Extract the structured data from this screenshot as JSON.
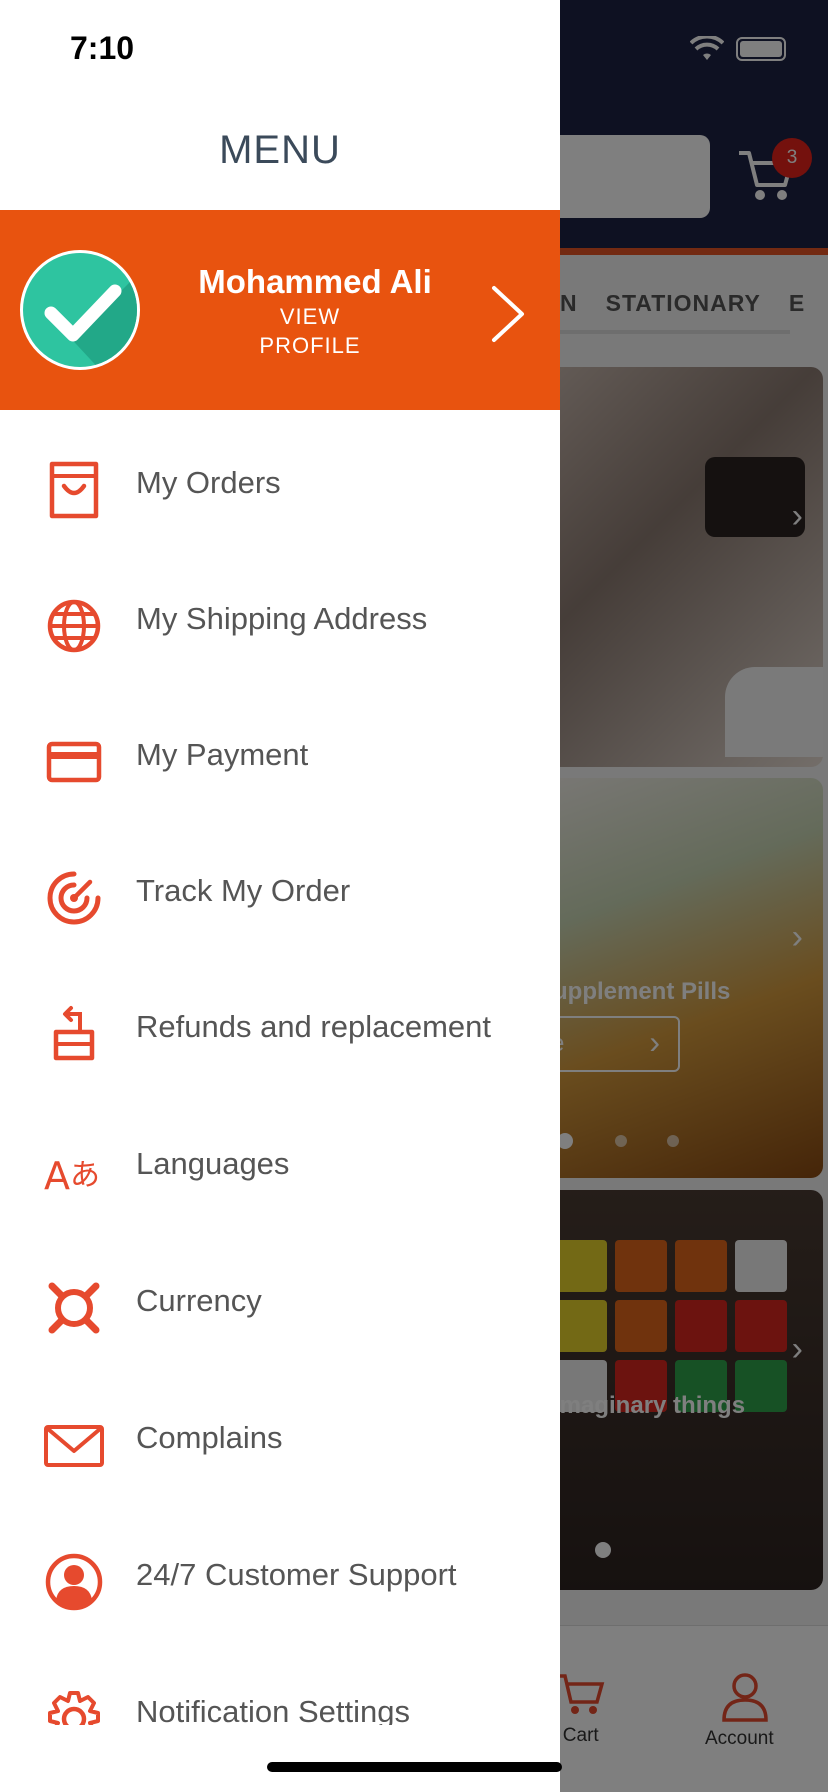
{
  "status_bar": {
    "time": "7:10"
  },
  "drawer": {
    "title": "MENU",
    "profile": {
      "name": "Mohammed Ali",
      "view_line1": "VIEW",
      "view_line2": "PROFILE"
    },
    "items": [
      {
        "label": "My Orders",
        "icon": "shopping-bag-icon"
      },
      {
        "label": "My Shipping Address",
        "icon": "globe-icon"
      },
      {
        "label": "My Payment",
        "icon": "credit-card-icon"
      },
      {
        "label": "Track My Order",
        "icon": "target-icon"
      },
      {
        "label": "Refunds and replacement",
        "icon": "refund-icon"
      },
      {
        "label": "Languages",
        "icon": "language-icon"
      },
      {
        "label": "Currency",
        "icon": "currency-icon"
      },
      {
        "label": "Complains",
        "icon": "mail-icon"
      },
      {
        "label": "24/7 Customer Support",
        "icon": "user-circle-icon"
      },
      {
        "label": "Notification Settings",
        "icon": "gear-icon"
      }
    ]
  },
  "background": {
    "cart_count": "3",
    "categories": [
      "N",
      "STATIONARY",
      "E"
    ],
    "cards": [
      {
        "text": ""
      },
      {
        "text": "upplement Pills",
        "button": "e"
      },
      {
        "text": "imaginary things"
      }
    ],
    "tabs": [
      {
        "label": "y Cart"
      },
      {
        "label": "Account"
      }
    ]
  },
  "colors": {
    "accent": "#e8530f",
    "icon": "#e64a2e",
    "header_bg": "#1d2344",
    "avatar_bg": "#2ec4a0"
  }
}
